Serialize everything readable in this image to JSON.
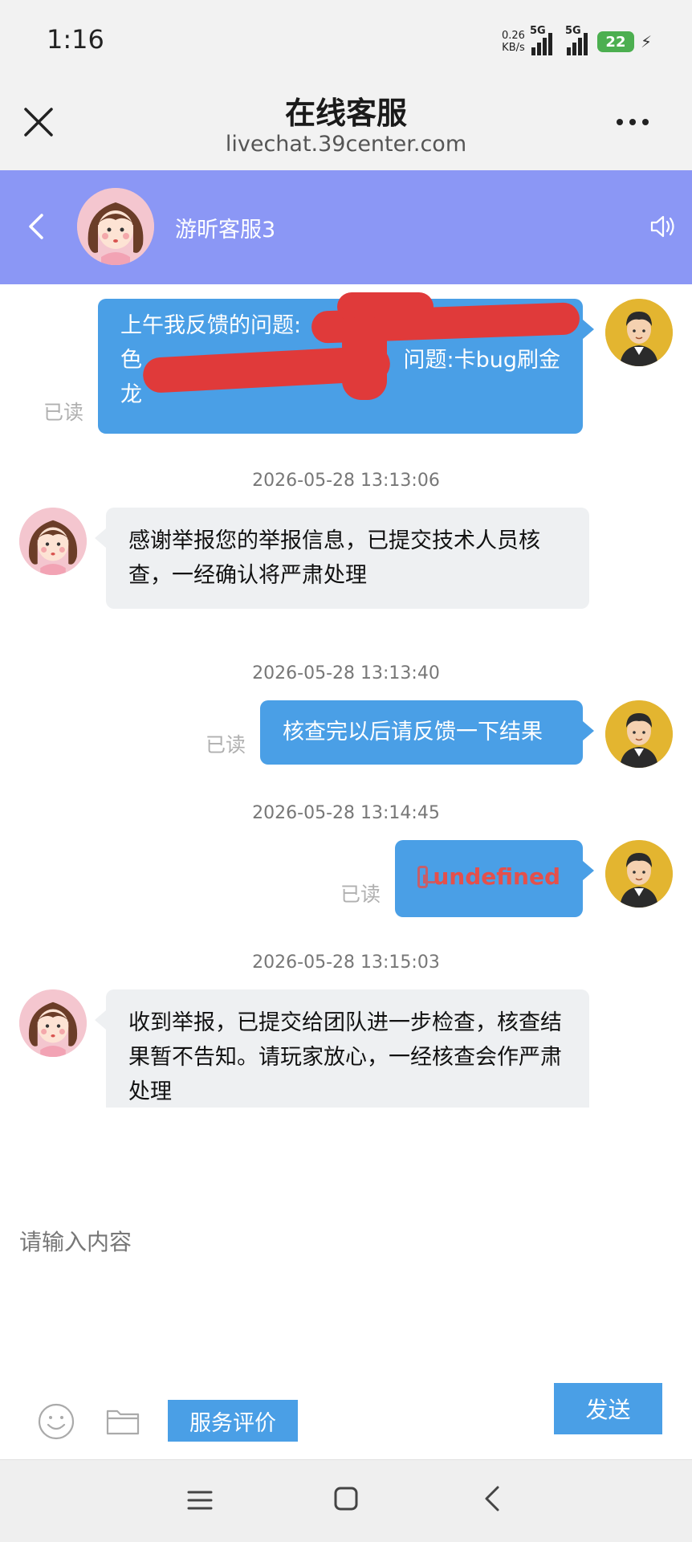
{
  "status_bar": {
    "time": "1:16",
    "net_speed_value": "0.26",
    "net_speed_unit": "KB/s",
    "sim1_label": "5G",
    "sim2_label": "5G",
    "battery_level": "22"
  },
  "browser": {
    "title": "在线客服",
    "url": "livechat.39center.com"
  },
  "chat_header": {
    "agent_name": "游昕客服3"
  },
  "messages": [
    {
      "sender": "user",
      "read_label": "已读",
      "lines": [
        "上午我反馈的问题:",
        "色",
        "问题:卡bug刷金",
        "龙"
      ]
    },
    {
      "timestamp": "2026-05-28 13:13:06",
      "sender": "agent",
      "text": "感谢举报您的举报信息，已提交技术人员核查，一经确认将严肃处理"
    },
    {
      "timestamp": "2026-05-28 13:13:40",
      "sender": "user",
      "read_label": "已读",
      "text": "核查完以后请反馈一下结果"
    },
    {
      "timestamp": "2026-05-28 13:14:45",
      "sender": "user",
      "read_label": "已读",
      "text": "undefined"
    },
    {
      "timestamp": "2026-05-28 13:15:03",
      "sender": "agent",
      "text": "收到举报，已提交给团队进一步检查，核查结果暂不告知。请玩家放心，一经核查会作严肃处理"
    }
  ],
  "input": {
    "placeholder": "请输入内容",
    "value": ""
  },
  "toolbar": {
    "rate_label": "服务评价",
    "send_label": "发送"
  },
  "colors": {
    "chat_header_bg": "#8b97f5",
    "bubble_out": "#4a9fe6",
    "bubble_in": "#eef0f2",
    "redaction": "#e03a3a"
  }
}
